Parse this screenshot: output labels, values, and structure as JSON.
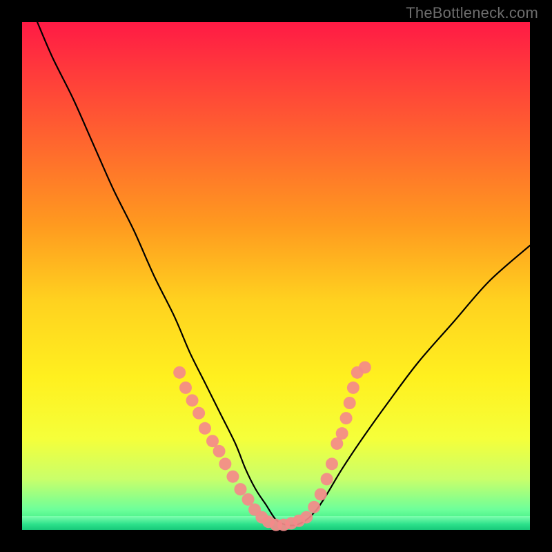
{
  "watermark": "TheBottleneck.com",
  "chart_data": {
    "type": "line",
    "title": "",
    "xlabel": "",
    "ylabel": "",
    "xlim": [
      0,
      100
    ],
    "ylim": [
      0,
      100
    ],
    "grid": false,
    "legend": false,
    "series": [
      {
        "name": "curve",
        "color": "#000000",
        "x": [
          3,
          6,
          10,
          14,
          18,
          22,
          26,
          30,
          33,
          36,
          39,
          42,
          44,
          46,
          48,
          50,
          52,
          54,
          56,
          58,
          60,
          63,
          67,
          72,
          78,
          85,
          92,
          100
        ],
        "y": [
          100,
          93,
          85,
          76,
          67,
          59,
          50,
          42,
          35,
          29,
          23,
          17,
          12,
          8,
          5,
          2,
          1,
          1,
          2,
          4,
          7,
          12,
          18,
          25,
          33,
          41,
          49,
          56
        ]
      }
    ],
    "markers": {
      "name": "dots",
      "color": "#f48a8a",
      "size": 9,
      "points": [
        {
          "x": 31.0,
          "y": 31.0
        },
        {
          "x": 32.2,
          "y": 28.0
        },
        {
          "x": 33.5,
          "y": 25.5
        },
        {
          "x": 34.8,
          "y": 23.0
        },
        {
          "x": 36.0,
          "y": 20.0
        },
        {
          "x": 37.5,
          "y": 17.5
        },
        {
          "x": 38.8,
          "y": 15.5
        },
        {
          "x": 40.0,
          "y": 13.0
        },
        {
          "x": 41.5,
          "y": 10.5
        },
        {
          "x": 43.0,
          "y": 8.0
        },
        {
          "x": 44.5,
          "y": 6.0
        },
        {
          "x": 45.8,
          "y": 4.0
        },
        {
          "x": 47.2,
          "y": 2.5
        },
        {
          "x": 48.5,
          "y": 1.6
        },
        {
          "x": 50.0,
          "y": 1.0
        },
        {
          "x": 51.5,
          "y": 1.0
        },
        {
          "x": 53.0,
          "y": 1.3
        },
        {
          "x": 54.5,
          "y": 1.8
        },
        {
          "x": 56.0,
          "y": 2.5
        },
        {
          "x": 57.5,
          "y": 4.5
        },
        {
          "x": 58.8,
          "y": 7.0
        },
        {
          "x": 60.0,
          "y": 10.0
        },
        {
          "x": 61.0,
          "y": 13.0
        },
        {
          "x": 62.0,
          "y": 17.0
        },
        {
          "x": 63.0,
          "y": 19.0
        },
        {
          "x": 63.8,
          "y": 22.0
        },
        {
          "x": 64.5,
          "y": 25.0
        },
        {
          "x": 65.2,
          "y": 28.0
        },
        {
          "x": 66.0,
          "y": 31.0
        },
        {
          "x": 67.5,
          "y": 32.0
        }
      ]
    }
  },
  "colors": {
    "frame": "#000000",
    "curve": "#000000",
    "dots": "#f48a8a",
    "watermark": "#6d6d6d"
  }
}
